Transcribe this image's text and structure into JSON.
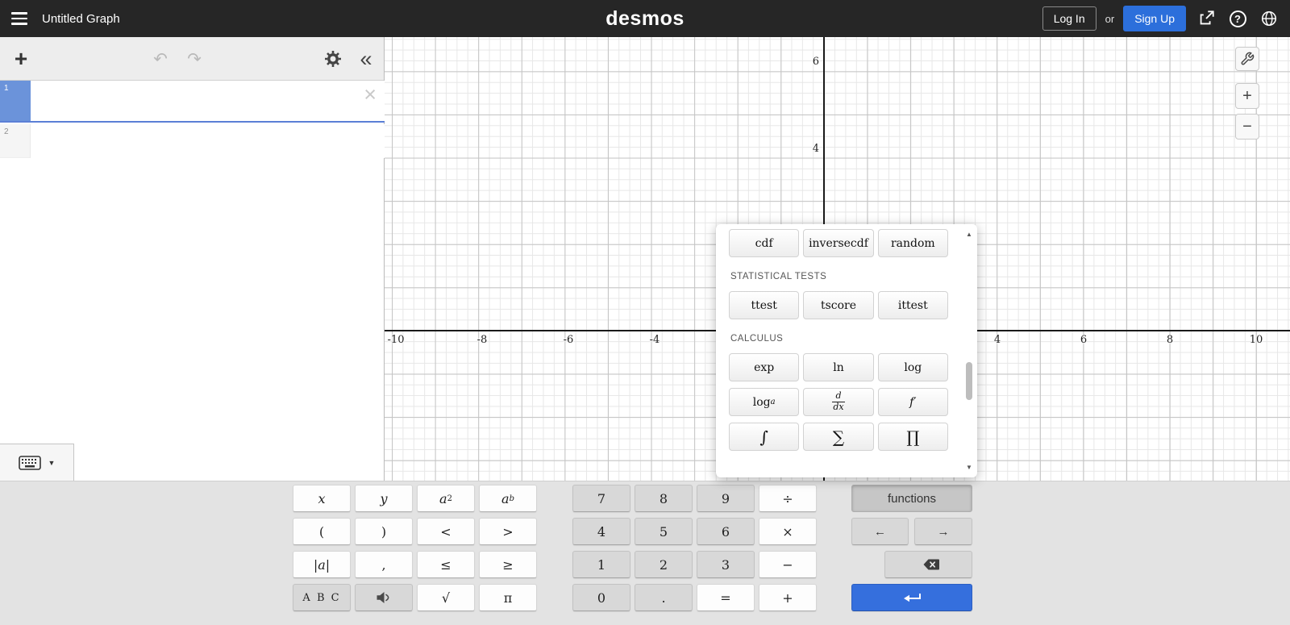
{
  "topbar": {
    "title": "Untitled Graph",
    "logo": "desmos",
    "login": "Log In",
    "or": "or",
    "signup": "Sign Up",
    "help": "?"
  },
  "expr_panel": {
    "add": "+",
    "undo": "↶",
    "redo": "↷",
    "collapse": "«",
    "rows": [
      {
        "index": "1"
      },
      {
        "index": "2"
      }
    ],
    "clear": "×",
    "keyboard_caret": "▼"
  },
  "graph": {
    "x_ticks": [
      "-10",
      "-8",
      "-6",
      "-4",
      "4",
      "6",
      "8",
      "10"
    ],
    "y_ticks": [
      "6",
      "4"
    ],
    "zoom_in": "+",
    "zoom_out": "−"
  },
  "functions_popup": {
    "top_row": [
      "cdf",
      "inversecdf",
      "random"
    ],
    "stats_header": "STATISTICAL TESTS",
    "stats_row": [
      "ttest",
      "tscore",
      "ittest"
    ],
    "calc_header": "CALCULUS",
    "calc_row1": [
      "exp",
      "ln",
      "log"
    ],
    "log_base": {
      "base": "log",
      "sub": "a"
    },
    "ddx": {
      "num": "d",
      "den": "dx"
    },
    "fprime": "f′",
    "calc_row3": [
      "∫",
      "∑",
      "∏"
    ],
    "scroll_up": "▲",
    "scroll_down": "▼"
  },
  "keypad": {
    "x": "x",
    "y": "y",
    "a": "a",
    "sq": "2",
    "pow": "b",
    "lparen": "(",
    "rparen": ")",
    "lt": "<",
    "gt": ">",
    "pipe": "|",
    "comma": ",",
    "le": "≤",
    "ge": "≥",
    "abc": "A B C",
    "sqrt": "√",
    "pi": "π",
    "d7": "7",
    "d8": "8",
    "d9": "9",
    "d4": "4",
    "d5": "5",
    "d6": "6",
    "d1": "1",
    "d2": "2",
    "d3": "3",
    "d0": "0",
    "div": "÷",
    "mul": "×",
    "minus": "−",
    "plus": "+",
    "dot": ".",
    "eq": "=",
    "functions": "functions",
    "larr": "←",
    "rarr": "→"
  },
  "colors": {
    "accent": "#2c6fdb",
    "enter_key": "#356fdd",
    "selected_tab": "#6b93da"
  }
}
